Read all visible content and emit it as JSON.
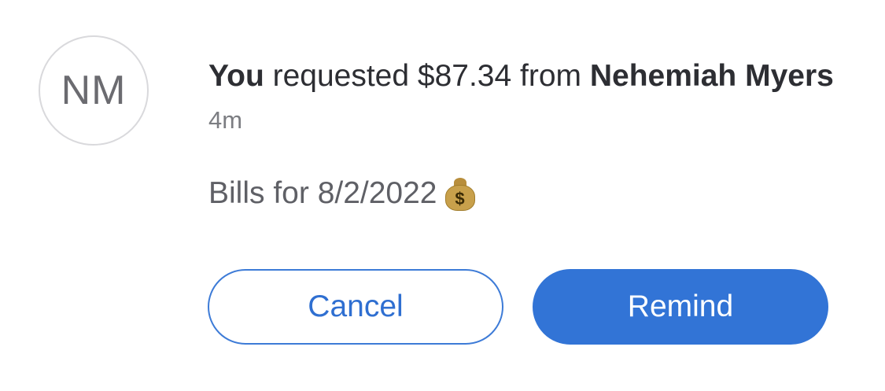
{
  "request": {
    "avatar_initials": "NM",
    "actor": "You",
    "verb_text": " requested $87.34 from ",
    "recipient": "Nehemiah Myers",
    "time_ago": "4m",
    "note": "Bills for 8/2/2022",
    "note_icon": "money-bag-icon"
  },
  "actions": {
    "cancel_label": "Cancel",
    "remind_label": "Remind"
  },
  "colors": {
    "primary": "#3274d6",
    "text_dark": "#2d2e33",
    "text_muted": "#7c7d82"
  }
}
